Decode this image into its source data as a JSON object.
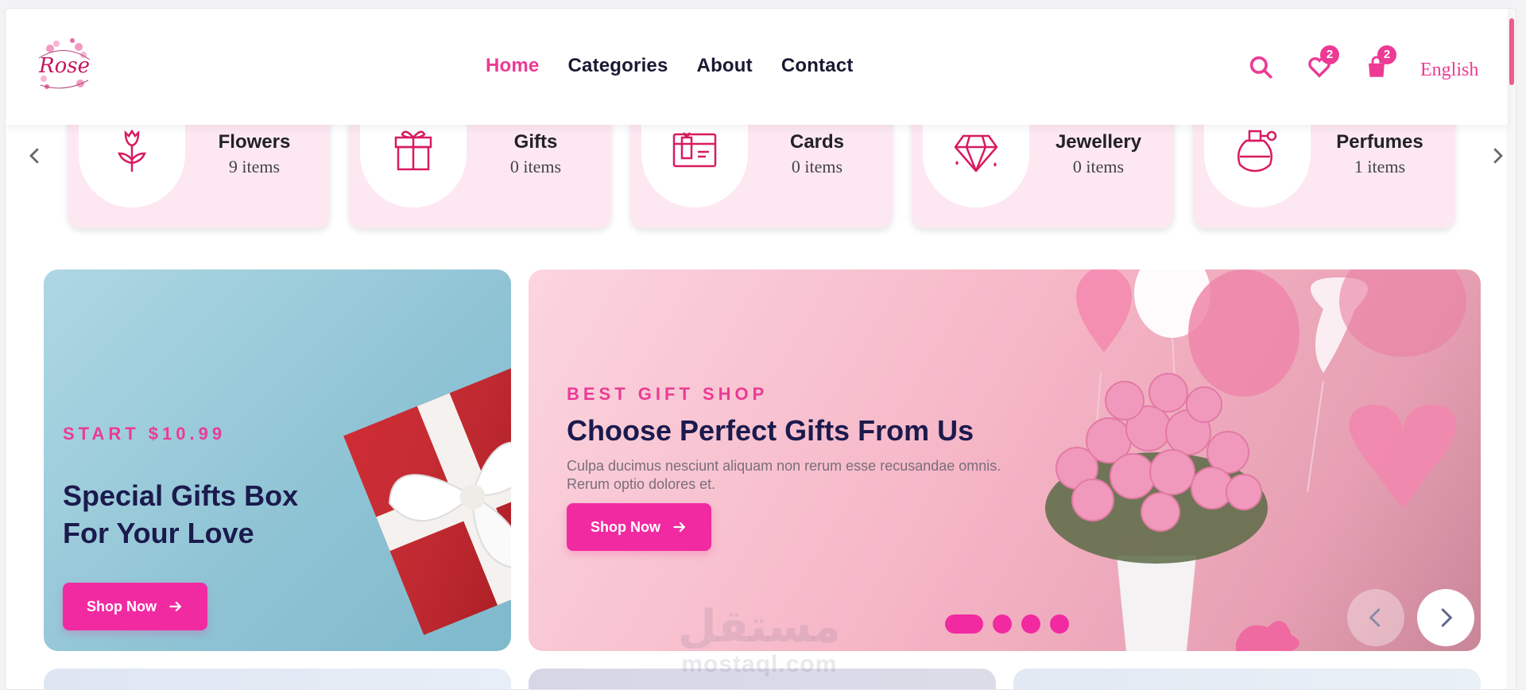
{
  "header": {
    "logo_text": "Rose",
    "nav": [
      {
        "label": "Home",
        "active": true
      },
      {
        "label": "Categories",
        "active": false
      },
      {
        "label": "About",
        "active": false
      },
      {
        "label": "Contact",
        "active": false
      }
    ],
    "wishlist_count": "2",
    "cart_count": "2",
    "language": "English",
    "icons": [
      "search-icon",
      "heart-icon",
      "shopping-bag-icon"
    ]
  },
  "categories": [
    {
      "name": "Flowers",
      "count": "9 items",
      "icon": "flower-icon"
    },
    {
      "name": "Gifts",
      "count": "0 items",
      "icon": "gift-icon"
    },
    {
      "name": "Cards",
      "count": "0 items",
      "icon": "card-icon"
    },
    {
      "name": "Jewellery",
      "count": "0 items",
      "icon": "diamond-icon"
    },
    {
      "name": "Perfumes",
      "count": "1 items",
      "icon": "perfume-icon"
    }
  ],
  "promo": {
    "kicker": "START $10.99",
    "title_line1": "Special Gifts Box",
    "title_line2": "For Your Love",
    "button": "Shop Now"
  },
  "hero": {
    "kicker": "BEST GIFT SHOP",
    "title": "Choose Perfect Gifts From Us",
    "description": "Culpa ducimus nesciunt aliquam non rerum esse recusandae omnis. Rerum optio dolores et.",
    "button": "Shop Now",
    "slides": 4,
    "active_slide": 1
  },
  "watermark": {
    "arabic": "مستقل",
    "latin": "mostaql.com"
  },
  "colors": {
    "accent": "#ec3a95",
    "button": "#f22aa1",
    "heading": "#1b1a4d",
    "card_bg": "#fde8f2"
  }
}
